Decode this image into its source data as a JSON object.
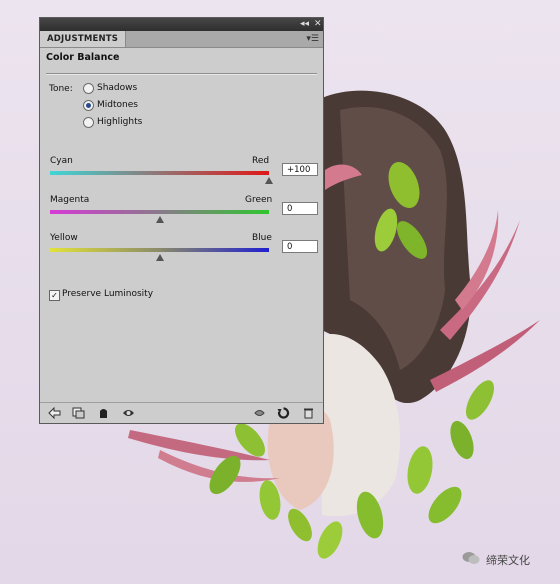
{
  "panel": {
    "tab_label": "ADJUSTMENTS",
    "title": "Color Balance",
    "tone_label": "Tone:",
    "tone_options": [
      "Shadows",
      "Midtones",
      "Highlights"
    ],
    "tone_selected": "Midtones",
    "sliders": [
      {
        "left_label": "Cyan",
        "right_label": "Red",
        "value": "+100",
        "numeric": 100
      },
      {
        "left_label": "Magenta",
        "right_label": "Green",
        "value": "0",
        "numeric": 0
      },
      {
        "left_label": "Yellow",
        "right_label": "Blue",
        "value": "0",
        "numeric": 0
      }
    ],
    "preserve_luminosity_label": "Preserve Luminosity",
    "preserve_luminosity_checked": true,
    "bottom_icons": [
      "back-arrow-icon",
      "clip-to-layer-icon",
      "layer-visibility-icon",
      "view-previous-icon",
      "eye-icon",
      "reset-icon",
      "delete-icon"
    ]
  },
  "watermark": {
    "text": "缔荣文化",
    "icon": "wechat-icon"
  },
  "colors": {
    "panel_bg": "#cdcdcd",
    "titlebar": "#3a3a3a",
    "background": "#e9e1ec"
  }
}
